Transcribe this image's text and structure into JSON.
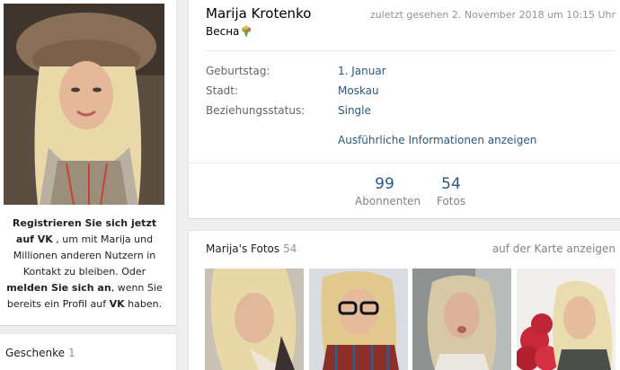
{
  "profile": {
    "name": "Marija Krotenko",
    "last_seen": "zuletzt gesehen 2. November 2018 um 10:15 Uhr",
    "status": "Весна",
    "status_icon": "bouquet-emoji-icon"
  },
  "details": {
    "birthday_label": "Geburtstag:",
    "birthday_value": "1. Januar",
    "city_label": "Stadt:",
    "city_value": "Moskau",
    "relationship_label": "Beziehungsstatus:",
    "relationship_value": "Single",
    "more_link": "Ausführliche Informationen anzeigen"
  },
  "counters": [
    {
      "count": "99",
      "label": "Abonnenten"
    },
    {
      "count": "54",
      "label": "Fotos"
    }
  ],
  "register": {
    "bold1": "Registrieren Sie sich jetzt auf VK",
    "text1": " ,",
    "text2": "um mit Marija und Millionen anderen Nutzern in Kontakt zu bleiben. Oder ",
    "bold2": "melden Sie sich an",
    "text3": ", wenn Sie bereits ein Profil auf ",
    "bold3": "VK",
    "text4": " haben."
  },
  "gifts": {
    "label": "Geschenke",
    "count": "1"
  },
  "photos": {
    "title": "Marija's Fotos",
    "count": "54",
    "map_link": "auf der Karte anzeigen"
  },
  "colors": {
    "link": "#2a5885",
    "muted": "#939393",
    "background": "#edeef0"
  }
}
